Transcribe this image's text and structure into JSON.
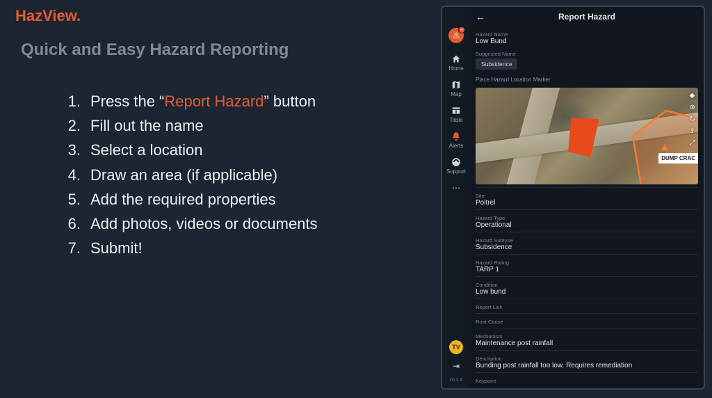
{
  "brand": {
    "name": "HazView",
    "suffix": "."
  },
  "subtitle": "Quick and Easy Hazard Reporting",
  "steps": [
    {
      "num": "1.",
      "pre": "Press the “",
      "hl": "Report Hazard",
      "post": "” button"
    },
    {
      "num": "2.",
      "text": "Fill out the name"
    },
    {
      "num": "3.",
      "text": "Select a location"
    },
    {
      "num": "4.",
      "text": "Draw an area (if applicable)"
    },
    {
      "num": "5.",
      "text": "Add the required properties"
    },
    {
      "num": "6.",
      "text": "Add photos, videos or documents"
    },
    {
      "num": "7.",
      "text": "Submit!"
    }
  ],
  "app": {
    "header": {
      "title": "Report Hazard"
    },
    "sidebar": {
      "items": [
        {
          "label": "Home"
        },
        {
          "label": "Map"
        },
        {
          "label": "Table"
        },
        {
          "label": "Alerts"
        },
        {
          "label": "Support"
        }
      ],
      "avatar": "TV",
      "version": "v0.2.8"
    },
    "form": {
      "hazard_name_label": "Hazard Name",
      "hazard_name": "Low Bund",
      "suggested_name_label": "Suggested Name",
      "suggested_chip": "Subsidence",
      "map_label": "Place Hazard Location Marker",
      "map_annotation": "DUMP CRAC",
      "fields": [
        {
          "label": "Site",
          "value": "Poitrel"
        },
        {
          "label": "Hazard Type",
          "value": "Operational"
        },
        {
          "label": "Hazard Subtype",
          "value": "Subsidence"
        },
        {
          "label": "Hazard Rating",
          "value": "TARP 1"
        },
        {
          "label": "Condition",
          "value": "Low bund"
        },
        {
          "label": "Report Link",
          "value": ""
        },
        {
          "label": "Root Cause",
          "value": ""
        },
        {
          "label": "Mechanism",
          "value": "Maintenance post rainfall"
        },
        {
          "label": "Description",
          "value": "Bunding post rainfall too low. Requires remediation"
        },
        {
          "label": "Keypoint",
          "value": ""
        }
      ]
    }
  }
}
